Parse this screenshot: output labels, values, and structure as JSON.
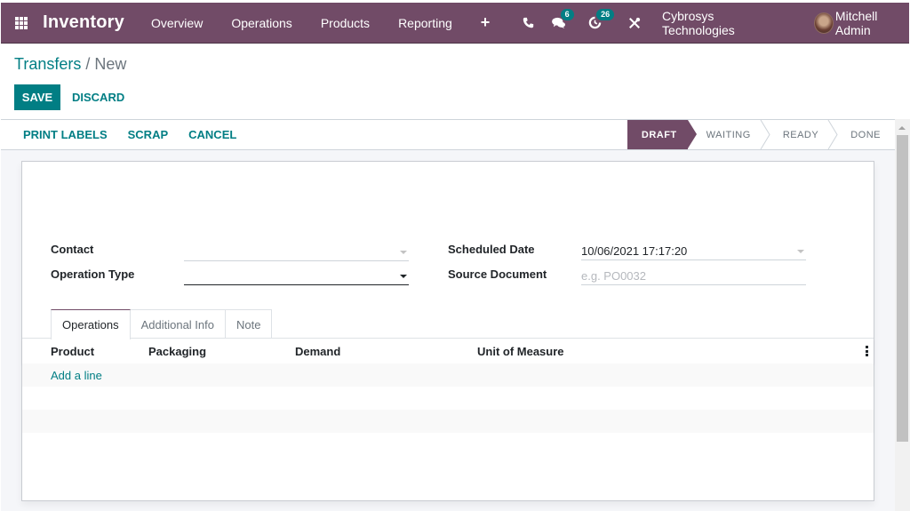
{
  "navbar": {
    "app_name": "Inventory",
    "menu": [
      "Overview",
      "Operations",
      "Products",
      "Reporting"
    ],
    "icons": {
      "apps": "apps-grid-icon",
      "quick_create": "plus-icon",
      "phone": "phone-icon",
      "messages": "chat-icon",
      "activities": "clock-icon",
      "debug": "tools-icon"
    },
    "messages_count": "6",
    "activities_count": "26",
    "company": "Cybrosys Technologies",
    "user": "Mitchell Admin"
  },
  "breadcrumb": {
    "parent": "Transfers",
    "separator": "/",
    "current": "New"
  },
  "actions": {
    "save": "SAVE",
    "discard": "DISCARD"
  },
  "statusbar": {
    "buttons": [
      "PRINT LABELS",
      "SCRAP",
      "CANCEL"
    ],
    "stages": [
      {
        "label": "DRAFT",
        "active": true
      },
      {
        "label": "WAITING",
        "active": false
      },
      {
        "label": "READY",
        "active": false
      },
      {
        "label": "DONE",
        "active": false
      }
    ]
  },
  "form": {
    "contact": {
      "label": "Contact",
      "value": ""
    },
    "operation_type": {
      "label": "Operation Type",
      "value": ""
    },
    "scheduled_date": {
      "label": "Scheduled Date",
      "value": "10/06/2021 17:17:20"
    },
    "source_document": {
      "label": "Source Document",
      "value": "",
      "placeholder": "e.g. PO0032"
    }
  },
  "tabs": [
    {
      "label": "Operations",
      "active": true
    },
    {
      "label": "Additional Info",
      "active": false
    },
    {
      "label": "Note",
      "active": false
    }
  ],
  "table": {
    "columns": [
      "Product",
      "Packaging",
      "Demand",
      "Unit of Measure"
    ],
    "add_line": "Add a line",
    "rows": []
  },
  "colors": {
    "brand": "#714b67",
    "accent": "#017e84"
  }
}
